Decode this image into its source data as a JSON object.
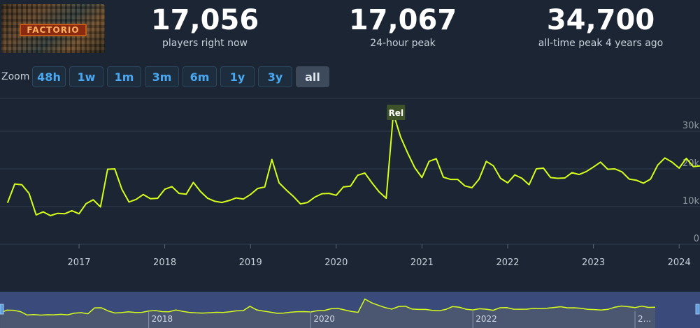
{
  "game": {
    "logo_text": "FACTORIO"
  },
  "stats": [
    {
      "value": "17,056",
      "label": "players right now"
    },
    {
      "value": "17,067",
      "label": "24-hour peak"
    },
    {
      "value": "34,700",
      "label": "all-time peak 4 years ago"
    }
  ],
  "zoom": {
    "label": "Zoom",
    "buttons": [
      "48h",
      "1w",
      "1m",
      "3m",
      "6m",
      "1y",
      "3y",
      "all"
    ],
    "active": "all"
  },
  "colors": {
    "line": "#d6ff1a",
    "background": "#1b2533",
    "accent": "#4aa8f0",
    "annotation_bg": "#3d5228"
  },
  "chart_data": {
    "type": "line",
    "x_ticks": [
      "2017",
      "2018",
      "2019",
      "2020",
      "2021",
      "2022",
      "2023",
      "2024"
    ],
    "y_ticks": [
      "0",
      "10k",
      "20k",
      "30k"
    ],
    "ylim": [
      0,
      40000
    ],
    "grid": true,
    "annotation": {
      "label": "Rel",
      "x": "2020-08",
      "y": 34700
    },
    "series": [
      {
        "values": [
          [
            "2016-03",
            11000
          ],
          [
            "2016-04",
            16000
          ],
          [
            "2016-05",
            15800
          ],
          [
            "2016-06",
            13500
          ],
          [
            "2016-07",
            7800
          ],
          [
            "2016-08",
            8600
          ],
          [
            "2016-09",
            7600
          ],
          [
            "2016-10",
            8200
          ],
          [
            "2016-11",
            8100
          ],
          [
            "2016-12",
            8900
          ],
          [
            "2017-01",
            8100
          ],
          [
            "2017-02",
            10800
          ],
          [
            "2017-03",
            11800
          ],
          [
            "2017-04",
            9900
          ],
          [
            "2017-05",
            19900
          ],
          [
            "2017-06",
            20000
          ],
          [
            "2017-07",
            14600
          ],
          [
            "2017-08",
            11200
          ],
          [
            "2017-09",
            11900
          ],
          [
            "2017-10",
            13200
          ],
          [
            "2017-11",
            12100
          ],
          [
            "2017-12",
            12200
          ],
          [
            "2018-01",
            14600
          ],
          [
            "2018-02",
            15300
          ],
          [
            "2018-03",
            13500
          ],
          [
            "2018-04",
            13300
          ],
          [
            "2018-05",
            16400
          ],
          [
            "2018-06",
            14000
          ],
          [
            "2018-07",
            12200
          ],
          [
            "2018-08",
            11400
          ],
          [
            "2018-09",
            11100
          ],
          [
            "2018-10",
            11600
          ],
          [
            "2018-11",
            12300
          ],
          [
            "2018-12",
            12000
          ],
          [
            "2019-01",
            13200
          ],
          [
            "2019-02",
            14800
          ],
          [
            "2019-03",
            15200
          ],
          [
            "2019-04",
            22500
          ],
          [
            "2019-05",
            16300
          ],
          [
            "2019-06",
            14400
          ],
          [
            "2019-07",
            12700
          ],
          [
            "2019-08",
            10700
          ],
          [
            "2019-09",
            11100
          ],
          [
            "2019-10",
            12500
          ],
          [
            "2019-11",
            13400
          ],
          [
            "2019-12",
            13500
          ],
          [
            "2020-01",
            13000
          ],
          [
            "2020-02",
            15200
          ],
          [
            "2020-03",
            15400
          ],
          [
            "2020-04",
            18300
          ],
          [
            "2020-05",
            18900
          ],
          [
            "2020-06",
            16300
          ],
          [
            "2020-07",
            13900
          ],
          [
            "2020-08",
            12200
          ],
          [
            "2020-09",
            34700
          ],
          [
            "2020-10",
            28500
          ],
          [
            "2020-11",
            24200
          ],
          [
            "2020-12",
            20300
          ],
          [
            "2021-01",
            17700
          ],
          [
            "2021-02",
            22000
          ],
          [
            "2021-03",
            22700
          ],
          [
            "2021-04",
            17800
          ],
          [
            "2021-05",
            17200
          ],
          [
            "2021-06",
            17200
          ],
          [
            "2021-07",
            15500
          ],
          [
            "2021-08",
            15000
          ],
          [
            "2021-09",
            17300
          ],
          [
            "2021-10",
            22000
          ],
          [
            "2021-11",
            20800
          ],
          [
            "2021-12",
            17500
          ],
          [
            "2022-01",
            16300
          ],
          [
            "2022-02",
            18400
          ],
          [
            "2022-03",
            17500
          ],
          [
            "2022-04",
            15800
          ],
          [
            "2022-05",
            20000
          ],
          [
            "2022-06",
            20200
          ],
          [
            "2022-07",
            17700
          ],
          [
            "2022-08",
            17500
          ],
          [
            "2022-09",
            17600
          ],
          [
            "2022-10",
            19000
          ],
          [
            "2022-11",
            18500
          ],
          [
            "2022-12",
            19300
          ],
          [
            "2023-01",
            20500
          ],
          [
            "2023-02",
            21800
          ],
          [
            "2023-03",
            19900
          ],
          [
            "2023-04",
            20000
          ],
          [
            "2023-05",
            19200
          ],
          [
            "2023-06",
            17300
          ],
          [
            "2023-07",
            17000
          ],
          [
            "2023-08",
            16200
          ],
          [
            "2023-09",
            17300
          ],
          [
            "2023-10",
            21000
          ],
          [
            "2023-11",
            22900
          ],
          [
            "2023-12",
            21800
          ],
          [
            "2024-01",
            20200
          ],
          [
            "2024-02",
            22800
          ],
          [
            "2024-03",
            20600
          ],
          [
            "2024-04",
            20800
          ]
        ]
      }
    ]
  },
  "navigator": {
    "labels": [
      "2018",
      "2020",
      "2022",
      "2..."
    ]
  }
}
